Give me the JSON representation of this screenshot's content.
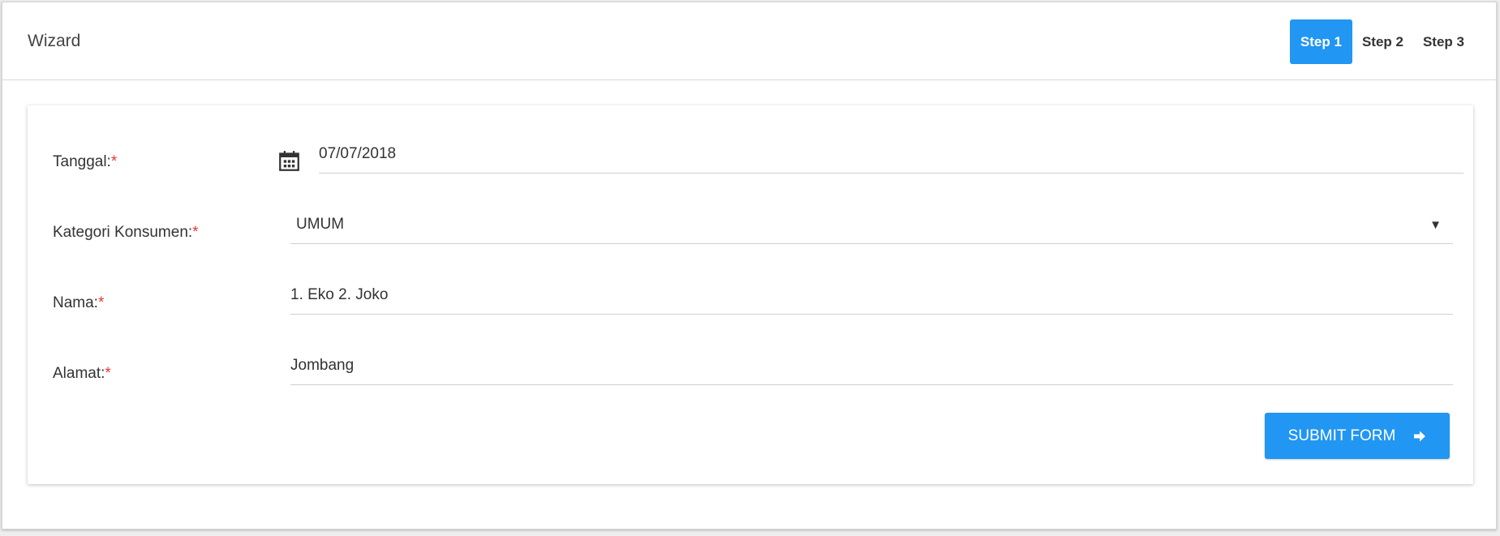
{
  "header": {
    "title": "Wizard",
    "steps": [
      {
        "label": "Step 1",
        "active": true
      },
      {
        "label": "Step 2",
        "active": false
      },
      {
        "label": "Step 3",
        "active": false
      }
    ]
  },
  "form": {
    "tanggal": {
      "label": "Tanggal:",
      "required": "*",
      "value": "07/07/2018",
      "icon": "calendar-icon"
    },
    "kategori": {
      "label": "Kategori Konsumen:",
      "required": "*",
      "value": "UMUM",
      "icon": "dropdown-arrow-icon"
    },
    "nama": {
      "label": "Nama:",
      "required": "*",
      "value": "1. Eko 2. Joko"
    },
    "alamat": {
      "label": "Alamat:",
      "required": "*",
      "value": "Jombang"
    },
    "submit": {
      "label": "SUBMIT FORM",
      "icon": "arrow-right-icon"
    }
  },
  "colors": {
    "accent": "#2196f3",
    "required": "#e53935"
  }
}
